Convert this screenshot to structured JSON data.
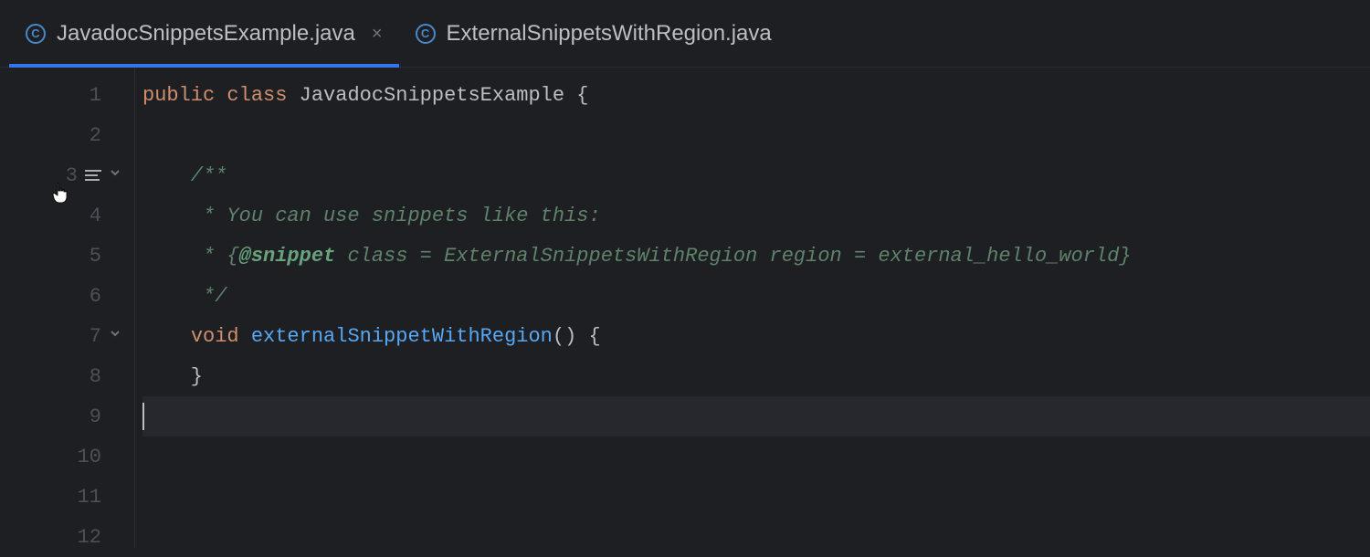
{
  "tabs": [
    {
      "label": "JavadocSnippetsExample.java",
      "icon": "C",
      "active": true,
      "closeable": true
    },
    {
      "label": "ExternalSnippetsWithRegion.java",
      "icon": "C",
      "active": false,
      "closeable": false
    }
  ],
  "gutter": {
    "lines": [
      "1",
      "2",
      "3",
      "4",
      "5",
      "6",
      "7",
      "8",
      "9",
      "10",
      "11",
      "12"
    ],
    "rendered_markers": {
      "3": true
    },
    "fold_markers": {
      "3": true,
      "7": true
    },
    "cursor_hover_line": "3"
  },
  "code": {
    "current_line": 9,
    "lines": {
      "1": {
        "tokens": [
          {
            "t": "public",
            "c": "k"
          },
          {
            "t": " ",
            "c": "p"
          },
          {
            "t": "class",
            "c": "k"
          },
          {
            "t": " ",
            "c": "p"
          },
          {
            "t": "JavadocSnippetsExample",
            "c": "cn"
          },
          {
            "t": " {",
            "c": "p"
          }
        ]
      },
      "2": {
        "tokens": []
      },
      "3": {
        "tokens": [
          {
            "t": "    /**",
            "c": "cmt"
          }
        ]
      },
      "4": {
        "tokens": [
          {
            "t": "     * You can use snippets like this:",
            "c": "cmt"
          }
        ]
      },
      "5": {
        "tokens": [
          {
            "t": "     * {",
            "c": "cmt"
          },
          {
            "t": "@snippet",
            "c": "cmttag"
          },
          {
            "t": " class = ExternalSnippetsWithRegion region = external_hello_world}",
            "c": "cmt"
          }
        ]
      },
      "6": {
        "tokens": [
          {
            "t": "     */",
            "c": "cmt"
          }
        ]
      },
      "7": {
        "tokens": [
          {
            "t": "    ",
            "c": "p"
          },
          {
            "t": "void",
            "c": "k"
          },
          {
            "t": " ",
            "c": "p"
          },
          {
            "t": "externalSnippetWithRegion",
            "c": "fn"
          },
          {
            "t": "() {",
            "c": "p"
          }
        ]
      },
      "8": {
        "tokens": [
          {
            "t": "    }",
            "c": "p"
          }
        ]
      },
      "9": {
        "tokens": []
      },
      "10": {
        "tokens": []
      },
      "11": {
        "tokens": []
      },
      "12": {
        "tokens": []
      }
    }
  }
}
